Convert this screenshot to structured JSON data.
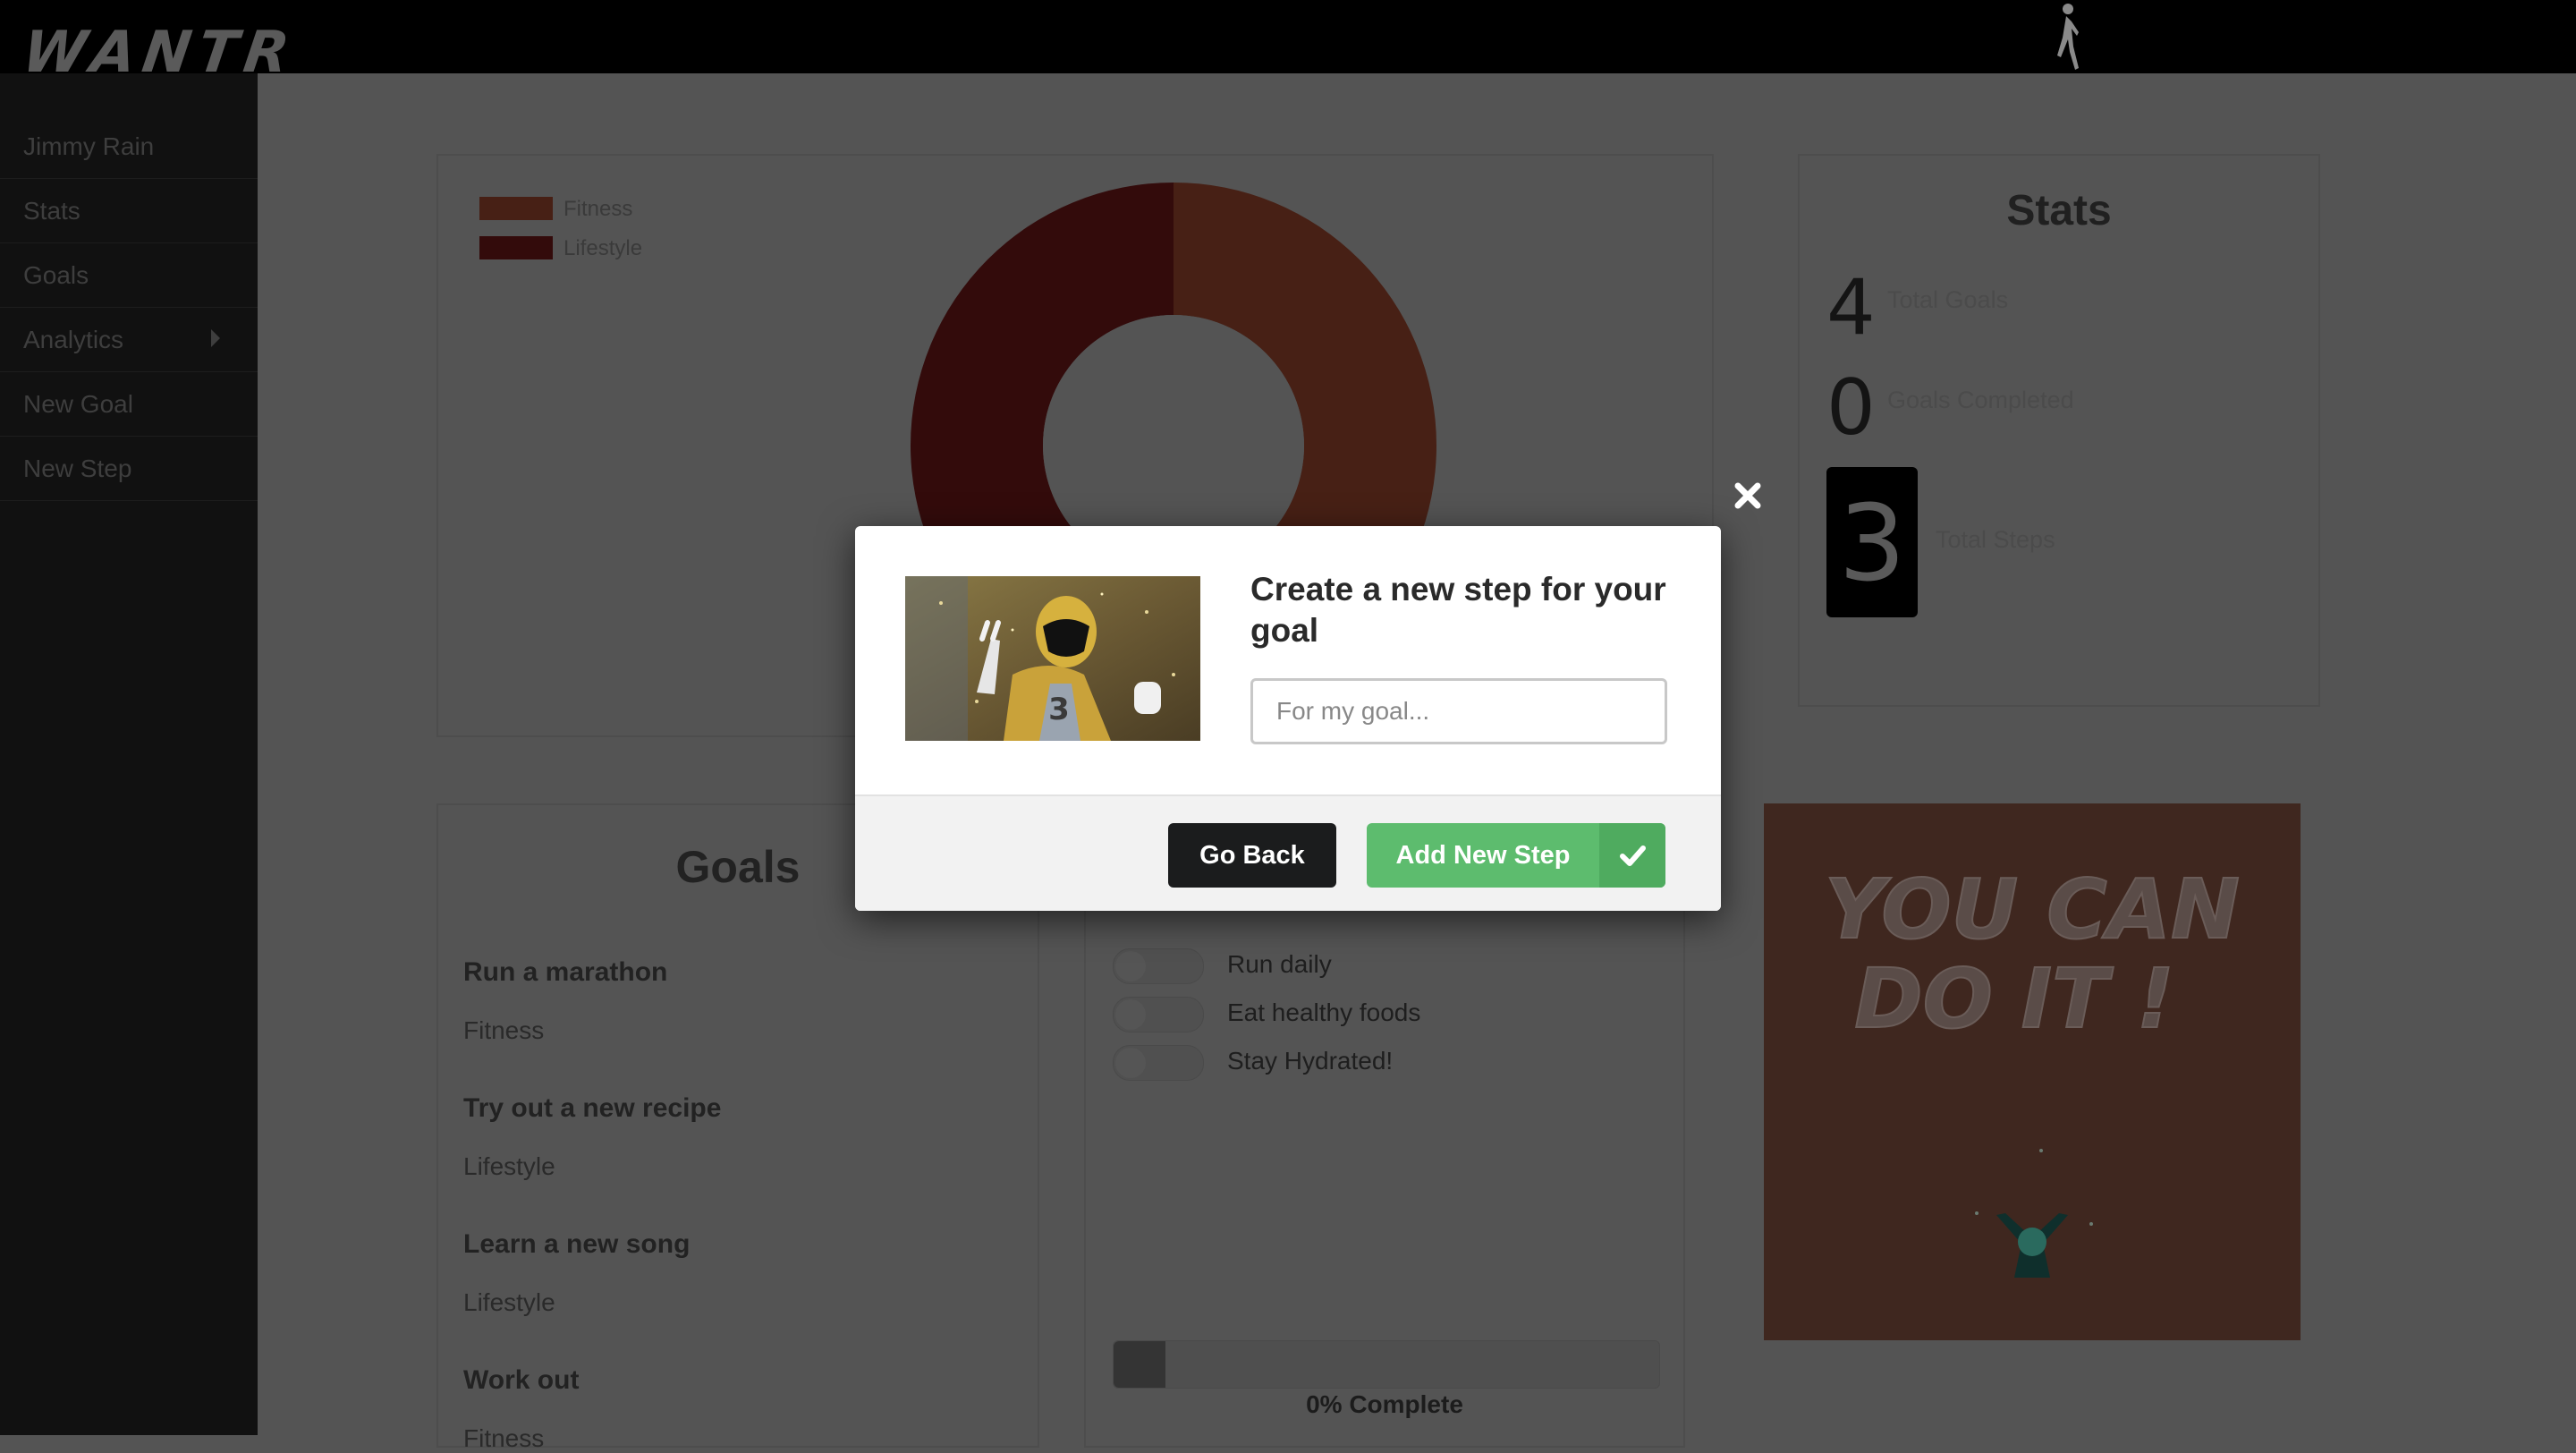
{
  "app": {
    "logo": "WANTR"
  },
  "sidebar": {
    "items": [
      {
        "label": "Jimmy Rain"
      },
      {
        "label": "Stats"
      },
      {
        "label": "Goals"
      },
      {
        "label": "Analytics",
        "has_submenu": true
      },
      {
        "label": "New Goal"
      },
      {
        "label": "New Step"
      }
    ]
  },
  "chart_data": {
    "type": "pie",
    "categories": [
      "Fitness",
      "Lifestyle"
    ],
    "values": [
      2,
      2
    ],
    "colors": [
      "#a94d33",
      "#7a1a1a"
    ]
  },
  "stats": {
    "title": "Stats",
    "total_goals": {
      "value": "4",
      "label": "Total Goals"
    },
    "goals_completed": {
      "value": "0",
      "label": "Goals Completed"
    },
    "total_steps": {
      "value": "3",
      "label": "Total Steps"
    }
  },
  "goals": {
    "title": "Goals",
    "items": [
      {
        "name": "Run a marathon",
        "category": "Fitness"
      },
      {
        "name": "Try out a new recipe",
        "category": "Lifestyle"
      },
      {
        "name": "Learn a new song",
        "category": "Lifestyle"
      },
      {
        "name": "Work out",
        "category": "Fitness"
      }
    ]
  },
  "steps": {
    "items": [
      {
        "label": "Run daily",
        "done": false
      },
      {
        "label": "Eat healthy foods",
        "done": false
      },
      {
        "label": "Stay Hydrated!",
        "done": false
      }
    ],
    "progress_percent": 0,
    "progress_label": "0% Complete"
  },
  "motivation": {
    "text_line1": "YOU CAN",
    "text_line2": "DO IT !"
  },
  "modal": {
    "title": "Create a new step for your goal",
    "input_placeholder": "For my goal...",
    "input_value": "",
    "back_label": "Go Back",
    "add_label": "Add New Step",
    "colors": {
      "add": "#5dbc6e",
      "back": "#1b1c1d"
    }
  }
}
